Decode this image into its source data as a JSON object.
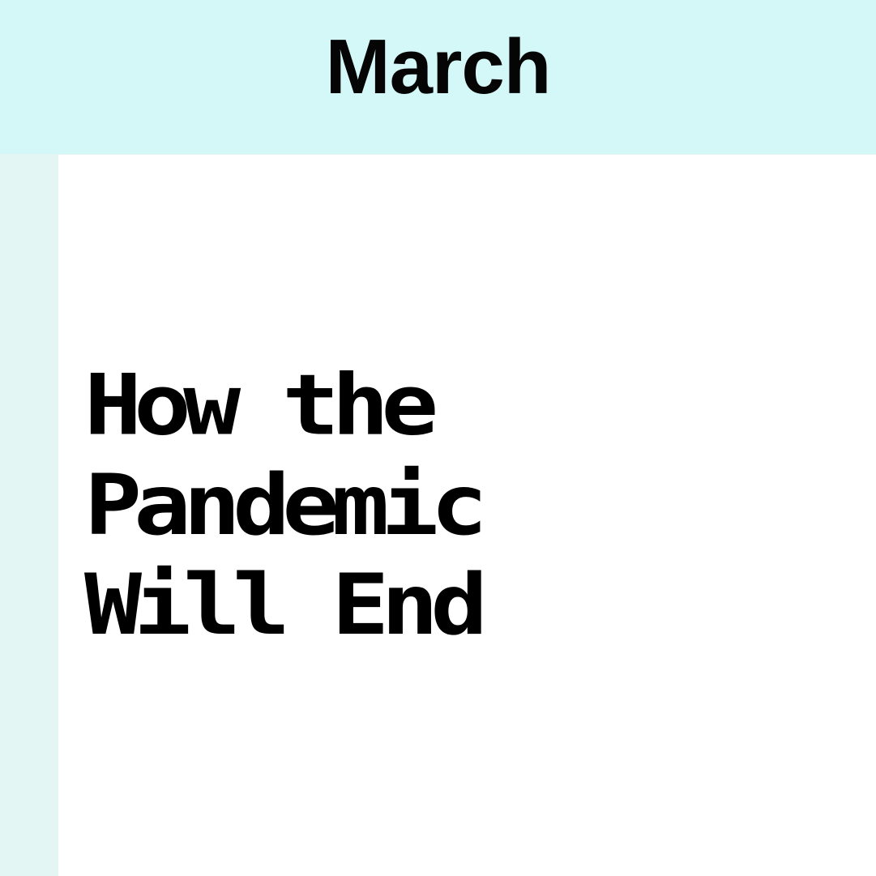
{
  "header": {
    "month": "March"
  },
  "article": {
    "title_lines": [
      "How the",
      "Pandemic",
      "Will End"
    ]
  },
  "colors": {
    "header_bg": "#d4f8f7",
    "rail_bg": "#e4f6f4",
    "content_bg": "#ffffff",
    "text": "#000000"
  }
}
